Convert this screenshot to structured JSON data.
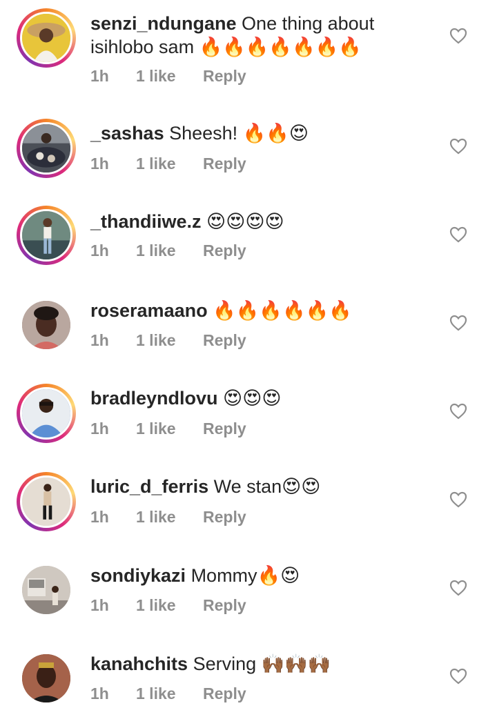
{
  "comments": [
    {
      "username": "senzi_ndungane",
      "text": "One thing about isihlobo sam 🔥🔥🔥🔥🔥🔥🔥",
      "time": "1h",
      "likes": "1 like",
      "reply": "Reply",
      "story_ring": true,
      "avatar_color": "#e9c93a"
    },
    {
      "username": "_sashas",
      "text": "Sheesh! 🔥🔥😍",
      "time": "1h",
      "likes": "1 like",
      "reply": "Reply",
      "story_ring": true,
      "avatar_color": "#3b3f48"
    },
    {
      "username": "_thandiiwe.z",
      "text": "😍😍😍😍",
      "time": "1h",
      "likes": "1 like",
      "reply": "Reply",
      "story_ring": true,
      "avatar_color": "#7a9488"
    },
    {
      "username": "roseramaano",
      "text": "🔥🔥🔥🔥🔥🔥",
      "time": "1h",
      "likes": "1 like",
      "reply": "Reply",
      "story_ring": false,
      "avatar_color": "#8c6e62"
    },
    {
      "username": "bradleyndlovu",
      "text": "😍😍😍",
      "time": "1h",
      "likes": "1 like",
      "reply": "Reply",
      "story_ring": true,
      "avatar_color": "#5d86c8"
    },
    {
      "username": "luric_d_ferris",
      "text": "We stan😍😍",
      "time": "1h",
      "likes": "1 like",
      "reply": "Reply",
      "story_ring": true,
      "avatar_color": "#d9d2c8"
    },
    {
      "username": "sondiykazi",
      "text": "Mommy🔥😍",
      "time": "1h",
      "likes": "1 like",
      "reply": "Reply",
      "story_ring": false,
      "avatar_color": "#b4aba3"
    },
    {
      "username": "kanahchits",
      "text": "Serving 🙌🏾🙌🏾🙌🏾",
      "time": "1h",
      "likes": "1 like",
      "reply": "Reply",
      "story_ring": false,
      "avatar_color": "#6b3a2c"
    }
  ],
  "icons": {
    "like": "heart-outline-icon"
  }
}
